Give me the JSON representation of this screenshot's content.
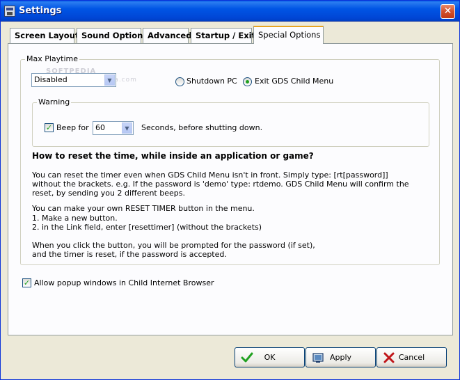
{
  "window": {
    "title": "Settings",
    "close_glyph": "✕"
  },
  "tabs": [
    {
      "label": "Screen Layout"
    },
    {
      "label": "Sound Options"
    },
    {
      "label": "Advanced"
    },
    {
      "label": "Startup / Exit"
    },
    {
      "label": "Special Options",
      "active": true
    }
  ],
  "max_playtime": {
    "group_label": "Max Playtime",
    "selected": "Disabled",
    "radio_shutdown": "Shutdown PC",
    "radio_exit": "Exit GDS Child Menu",
    "selected_radio": "Exit GDS Child Menu"
  },
  "warning": {
    "group_label": "Warning",
    "beep_label": "Beep for",
    "beep_checked": true,
    "seconds_value": "60",
    "seconds_text": "Seconds, before shutting down."
  },
  "help": {
    "heading": "How to reset the time, while inside an application or game?",
    "p1_l1": "You can reset the timer even when GDS Child Menu isn't in front. Simply type: [rt[password]]",
    "p1_l2": "without the brackets. e.g. If the password is 'demo' type: rtdemo. GDS Child Menu will confirm the",
    "p1_l3": "reset, by sending you 2 different beeps.",
    "p2_l1": "You can make your own RESET TIMER button in the menu.",
    "p2_l2": "1. Make a new button.",
    "p2_l3": "2. in the Link field, enter [resettimer] (without the brackets)",
    "p3_l1": "When you click the button, you will be prompted for the password (if set),",
    "p3_l2": "and the timer is reset, if the password is accepted."
  },
  "popup": {
    "label": "Allow popup windows in Child Internet Browser",
    "checked": true
  },
  "buttons": {
    "ok": "OK",
    "apply": "Apply",
    "cancel": "Cancel"
  },
  "watermark": {
    "line1": "SOFTPEDIA",
    "line2": "www.softpedia.com"
  },
  "colors": {
    "titlebar": "#0055e5",
    "tab_highlight": "#e8a420",
    "check_green": "#21a121",
    "cancel_red": "#c0161a"
  }
}
